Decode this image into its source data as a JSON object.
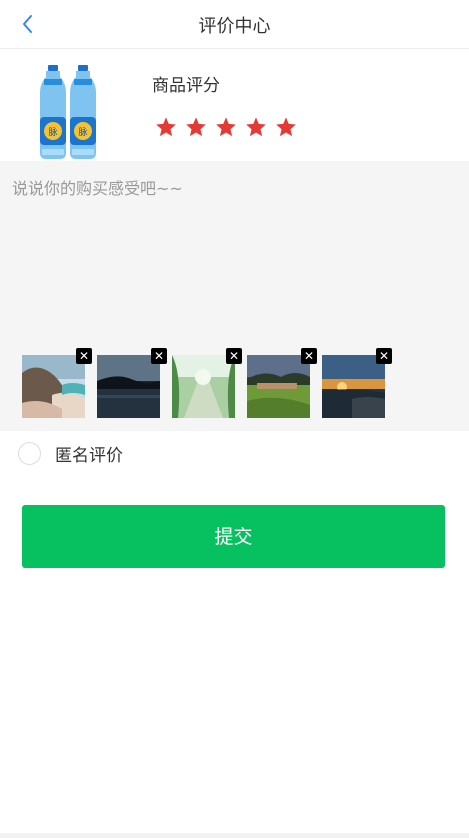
{
  "header": {
    "title": "评价中心"
  },
  "product": {
    "rating_label": "商品评分",
    "rating": 5,
    "max_rating": 5,
    "star_color": "#e53935"
  },
  "comment": {
    "placeholder": "说说你的购买感受吧~~",
    "value": ""
  },
  "photos": {
    "count": 5,
    "remove_icon": "close-icon"
  },
  "anonymous": {
    "label": "匿名评价",
    "checked": false
  },
  "submit": {
    "label": "提交",
    "color": "#07c160"
  }
}
